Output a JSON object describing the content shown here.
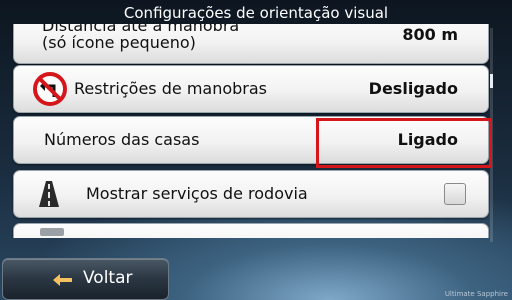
{
  "header": {
    "title": "Configurações de orientação visual"
  },
  "rows": [
    {
      "label_line1": "Distância até a manobra",
      "label_line2": "(só ícone pequeno)",
      "value": "800 m"
    },
    {
      "label": "Restrições de manobras",
      "value": "Desligado",
      "icon": "no-left-turn-icon"
    },
    {
      "label": "Números das casas",
      "value": "Ligado"
    },
    {
      "label": "Mostrar serviços de rodovia",
      "checked": false,
      "icon": "highway-icon"
    }
  ],
  "footer": {
    "back_label": "Voltar",
    "watermark": "Ultimate Sapphire"
  },
  "colors": {
    "highlight": "#d5171c",
    "row_bg": "#f2f2f2"
  }
}
